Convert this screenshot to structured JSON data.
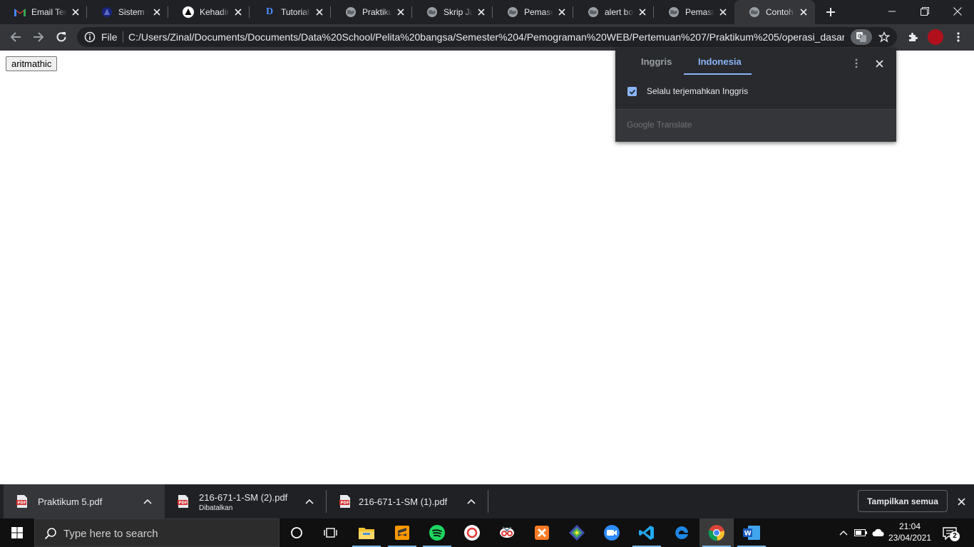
{
  "browser": {
    "tabs": [
      {
        "title": "Email Terki",
        "icon": "gmail-icon"
      },
      {
        "title": "Sistem Info",
        "icon": "sistem-icon"
      },
      {
        "title": "Kehadiran",
        "icon": "kehadiran-icon"
      },
      {
        "title": "Tutorial Bo",
        "icon": "tutorial-d-icon"
      },
      {
        "title": "Praktikum",
        "icon": "globe-icon"
      },
      {
        "title": "Skrip Java",
        "icon": "globe-icon"
      },
      {
        "title": "Pemasukan",
        "icon": "globe-icon"
      },
      {
        "title": "alert box",
        "icon": "globe-icon"
      },
      {
        "title": "Pemasukan",
        "icon": "globe-icon"
      },
      {
        "title": "Contoh Pe",
        "icon": "globe-icon",
        "active": true
      }
    ],
    "omnibox": {
      "scheme_label": "File",
      "url": "C:/Users/Zinal/Documents/Documents/Data%20School/Pelita%20bangsa/Semester%204/Pemograman%20WEB/Pertemuan%207/Praktikum%205/operasi_dasar_..."
    }
  },
  "page": {
    "button_label": "aritmathic"
  },
  "translate_popup": {
    "tabs": [
      "Inggris",
      "Indonesia"
    ],
    "active_tab": "Indonesia",
    "checkbox_label": "Selalu terjemahkan Inggris",
    "checkbox_checked": true,
    "brand": "Google Translate"
  },
  "downloads": {
    "items": [
      {
        "name": "Praktikum 5.pdf",
        "status": ""
      },
      {
        "name": "216-671-1-SM (2).pdf",
        "status": "Dibatalkan"
      },
      {
        "name": "216-671-1-SM (1).pdf",
        "status": ""
      }
    ],
    "show_all_label": "Tampilkan semua"
  },
  "taskbar": {
    "search_placeholder": "Type here to search",
    "time": "21:04",
    "date": "23/04/2021",
    "notification_count": "2"
  },
  "colors": {
    "accent_blue": "#8ab4f8",
    "tab_bg": "#202124",
    "toolbar_bg": "#35363a"
  }
}
